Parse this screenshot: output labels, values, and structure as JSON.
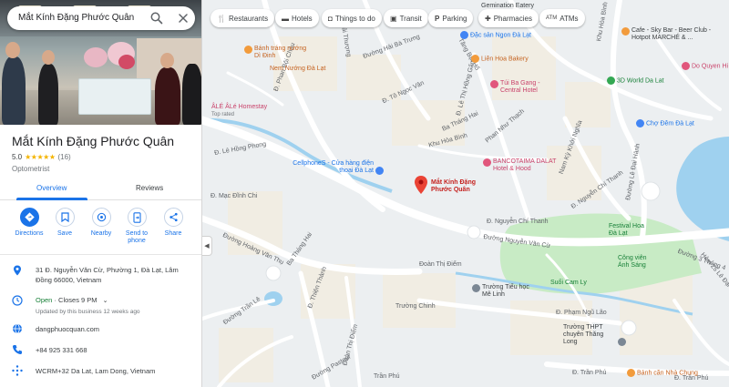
{
  "search": {
    "query": "Mắt Kính Đặng Phước Quân"
  },
  "place": {
    "name": "Mắt Kính Đặng Phước Quân",
    "rating": "5.0",
    "stars": "★★★★★",
    "review_count": "(16)",
    "category": "Optometrist"
  },
  "tabs": [
    {
      "label": "Overview"
    },
    {
      "label": "Reviews"
    }
  ],
  "actions": [
    {
      "label": "Directions",
      "icon": "directions-icon"
    },
    {
      "label": "Save",
      "icon": "bookmark-icon"
    },
    {
      "label": "Nearby",
      "icon": "nearby-icon"
    },
    {
      "label": "Send to phone",
      "icon": "send-to-phone-icon"
    },
    {
      "label": "Share",
      "icon": "share-icon"
    }
  ],
  "info": {
    "address": "31 Đ. Nguyễn Văn Cừ, Phường 1, Đà Lạt, Lâm Đồng 66000, Vietnam",
    "hours_status": "Open",
    "hours_detail": " · Closes 9 PM",
    "hours_updated": "Updated by this business 12 weeks ago",
    "website": "dangphuocquan.com",
    "phone": "+84 925 331 668",
    "plus_code": "WCRM+32 Da Lat, Lam Dong, Vietnam"
  },
  "chips": [
    {
      "label": "Restaurants",
      "icon": "fork-knife-icon"
    },
    {
      "label": "Hotels",
      "icon": "bed-icon"
    },
    {
      "label": "Things to do",
      "icon": "camera-icon"
    },
    {
      "label": "Transit",
      "icon": "bus-icon"
    },
    {
      "label": "Parking",
      "icon": "parking-icon"
    },
    {
      "label": "Pharmacies",
      "icon": "pharmacy-icon"
    },
    {
      "label": "ATMs",
      "icon": "atm-icon"
    }
  ],
  "map": {
    "marker_label": "Mắt Kính Đặng Phước Quân",
    "pois": {
      "banh_trang": "Bánh tráng nướng Dì Đinh",
      "nam_nuong": "Nem Nướng Đà Lạt",
      "dac_san": "Đặc sản Ngon Đà Lạt",
      "lien_hoa": "Liên Hoa Bakery",
      "tui_ba_gang": "Túi Ba Gang - Central Hotel",
      "ale_homestay": "ÂLÉ ÂLé Homestay",
      "ale_rated": "Top rated",
      "cellphones": "CellphoneS - Cửa hàng điện thoại Đà Lạt",
      "bancotaima": "BANCOTAIMA DALAT Hotel & Hood",
      "festival": "Festival Hoa Đà Lạt",
      "cong_vien": "Công viên Ánh Sáng",
      "suoi_cam_ly": "Suối Cam Ly",
      "truong_tieu_hoc": "Trường Tiểu học Mê Linh",
      "truong_chinh": "Trường Chinh",
      "thpt": "Trường THPT chuyên Thăng Long",
      "banh_can": "Bánh căn Nhà Chung",
      "cafe_sky": "Cafe - Sky Bar - Beer Club - Hotpot MARCHÉ & ...",
      "do_quyen": "Do Quyen Hi",
      "cho_dem": "Chợ Đêm Đà Lạt",
      "world_3d": "3D World Da Lat",
      "gemination": "Gemination Eatery"
    },
    "streets": {
      "s1": "Đ. Phan Bội Châu",
      "s2": "Đ. Tô Ngọc Vân",
      "s3": "Đường Hải Bà Trưng",
      "s4": "Đ. Lê Thị Hồng Gấm",
      "s5": "Ba Tháng Hai",
      "s6": "Phan Như Thạch",
      "s7": "Tăng Bạt Hổ",
      "s8": "Khu Hòa Bình",
      "s9": "Đ. Mạc Đĩnh Chi",
      "s10": "Đ. Nguyễn Chí Thanh",
      "s11": "Đường Nguyễn Văn Cừ",
      "s12": "Ba Tháng Hai",
      "s13": "Đoàn Thị Điểm",
      "s14": "Đường Hoàng Văn Thụ",
      "s15": "Đ. Thiện Thành",
      "s16": "Đường Trần Lê",
      "s17": "Đoàn Thị Điểm",
      "s18": "Đường Pasteur",
      "s19": "Đ. Phạm Ngũ Lão",
      "s20": "Đ. Trần Phú",
      "s21": "Nam Kỳ Khởi Nghĩa",
      "s22": "Đường Lê Đại Hành",
      "s23": "Khu Hòa Bình",
      "s24": "Đường 3 Tháng 4",
      "s25": "Hải Thượng",
      "s26": "Đ. Lê Hồng Phong",
      "s27": "Trần Phú",
      "s28": "Hẻm 25 Lê Đại Hành",
      "s29": "Đ. Trần Phú",
      "s30": "Đ. Nguyễn Chí Thanh"
    }
  }
}
